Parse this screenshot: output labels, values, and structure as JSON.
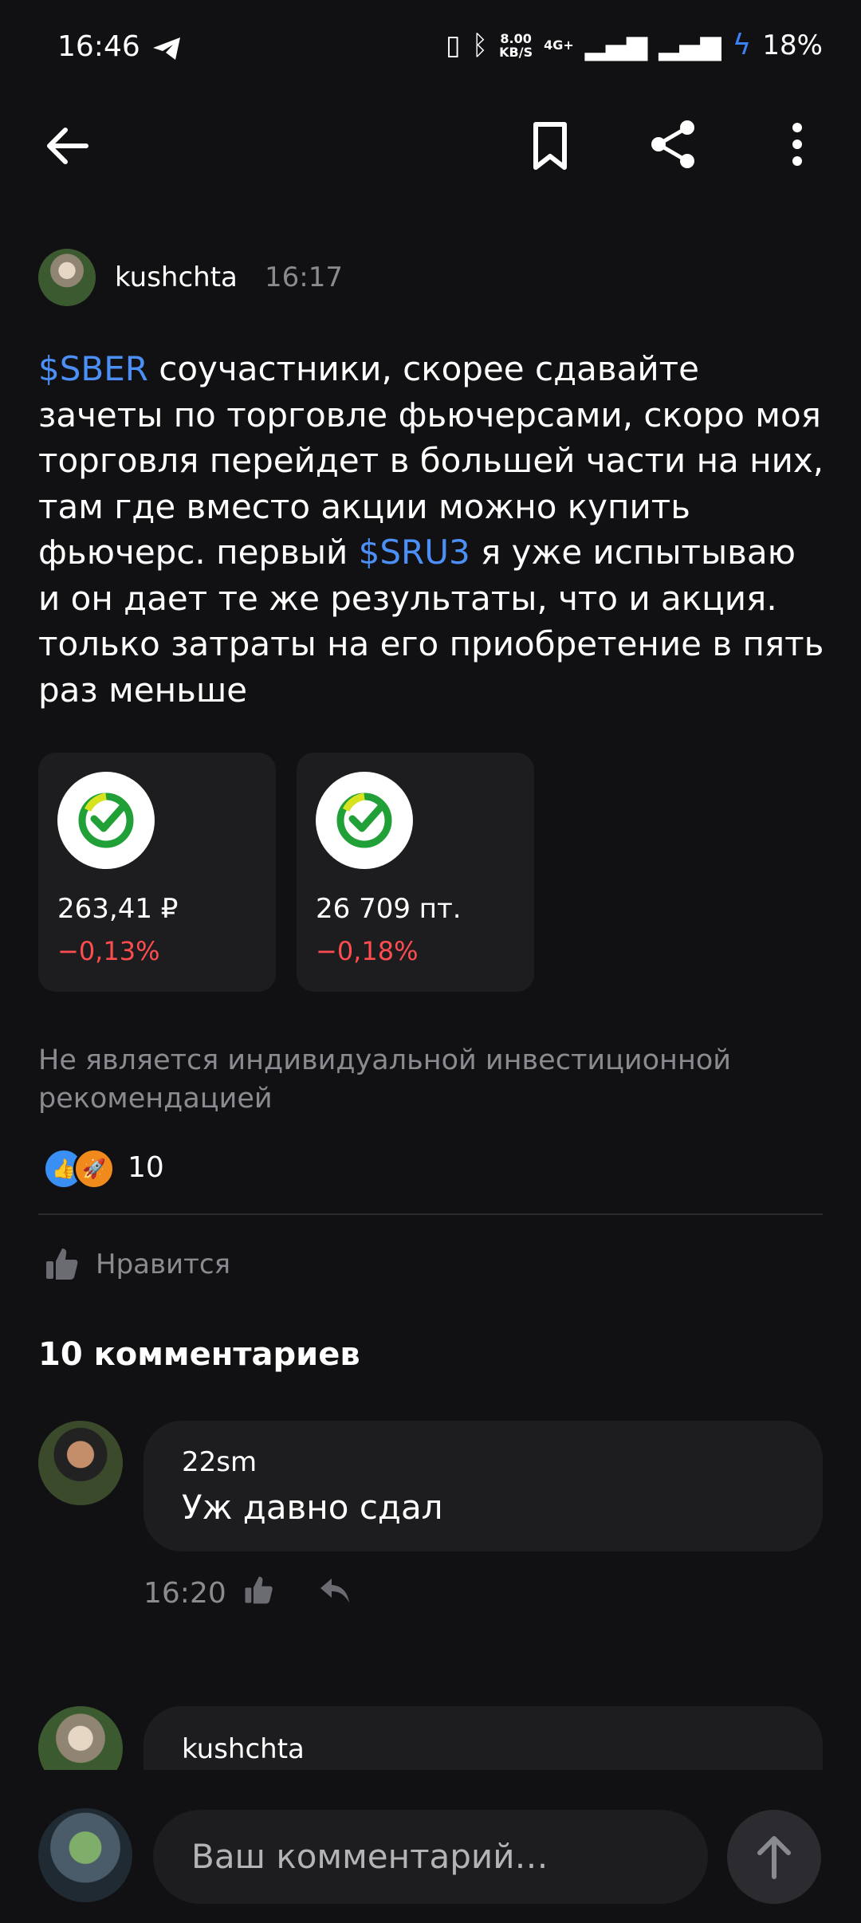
{
  "status_bar": {
    "time": "16:46",
    "net_speed_top": "8.00",
    "net_speed_bottom": "KB/S",
    "network": "4G+",
    "battery": "18%"
  },
  "post": {
    "author": "kushchta",
    "time": "16:17",
    "text_parts": [
      "$SBER",
      " соучастники, скорее сдавайте зачеты по торговле фьючерсами, скоро моя торговля перейдет в большей части на них, там где вместо акции можно купить фьючерс. первый ",
      "$SRU3",
      " я уже испытываю и он дает те же результаты, что и акция. только затраты на его приобретение в пять раз меньше"
    ],
    "instruments": [
      {
        "price": "263,41 ₽",
        "change": "−0,13%"
      },
      {
        "price": "26 709  пт.",
        "change": "−0,18%"
      }
    ],
    "disclaimer": "Не является индивидуальной инвестиционной рекомендацией",
    "reaction_count": "10",
    "like_label": "Нравится"
  },
  "comments": {
    "title": "10 комментариев",
    "items": [
      {
        "author": "22sm",
        "text": "Уж давно сдал",
        "time": "16:20"
      },
      {
        "author": "kushchta"
      }
    ]
  },
  "composer": {
    "placeholder": "Ваш комментарий…"
  },
  "colors": {
    "background": "#111113",
    "card": "#1d1d20",
    "ticker": "#4b8ff7",
    "negative": "#ff4d4f",
    "muted": "#8a8b90"
  }
}
